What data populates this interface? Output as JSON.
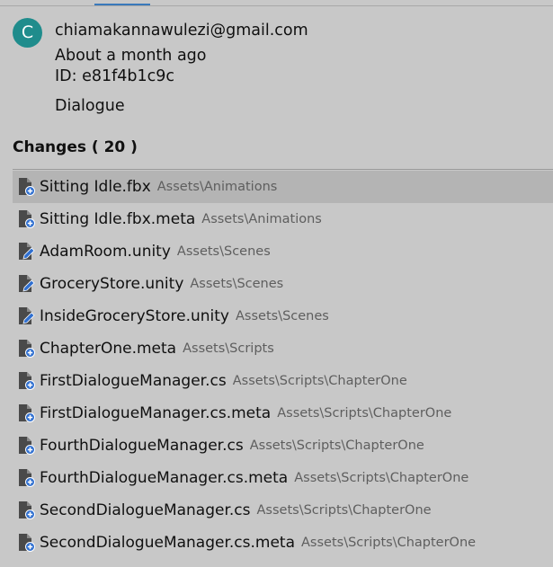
{
  "commit": {
    "avatar_letter": "C",
    "author": "chiamakannawulezi@gmail.com",
    "date": "About a month ago",
    "id": "ID: e81f4b1c9c",
    "message": "Dialogue"
  },
  "changes": {
    "title": "Changes ( 20 )",
    "items": [
      {
        "name": "Sitting Idle.fbx",
        "path": "Assets\\Animations",
        "status_icon": "added-file-icon"
      },
      {
        "name": "Sitting Idle.fbx.meta",
        "path": "Assets\\Animations",
        "status_icon": "added-file-icon"
      },
      {
        "name": "AdamRoom.unity",
        "path": "Assets\\Scenes",
        "status_icon": "modified-file-icon"
      },
      {
        "name": "GroceryStore.unity",
        "path": "Assets\\Scenes",
        "status_icon": "modified-file-icon"
      },
      {
        "name": "InsideGroceryStore.unity",
        "path": "Assets\\Scenes",
        "status_icon": "modified-file-icon"
      },
      {
        "name": "ChapterOne.meta",
        "path": "Assets\\Scripts",
        "status_icon": "added-file-icon"
      },
      {
        "name": "FirstDialogueManager.cs",
        "path": "Assets\\Scripts\\ChapterOne",
        "status_icon": "added-file-icon"
      },
      {
        "name": "FirstDialogueManager.cs.meta",
        "path": "Assets\\Scripts\\ChapterOne",
        "status_icon": "added-file-icon"
      },
      {
        "name": "FourthDialogueManager.cs",
        "path": "Assets\\Scripts\\ChapterOne",
        "status_icon": "added-file-icon"
      },
      {
        "name": "FourthDialogueManager.cs.meta",
        "path": "Assets\\Scripts\\ChapterOne",
        "status_icon": "added-file-icon"
      },
      {
        "name": "SecondDialogueManager.cs",
        "path": "Assets\\Scripts\\ChapterOne",
        "status_icon": "added-file-icon"
      },
      {
        "name": "SecondDialogueManager.cs.meta",
        "path": "Assets\\Scripts\\ChapterOne",
        "status_icon": "added-file-icon"
      }
    ]
  },
  "colors": {
    "avatar": "#1f8c8c",
    "status_badge": "#2f6fd0",
    "selected_row": "#b4b4b4"
  }
}
